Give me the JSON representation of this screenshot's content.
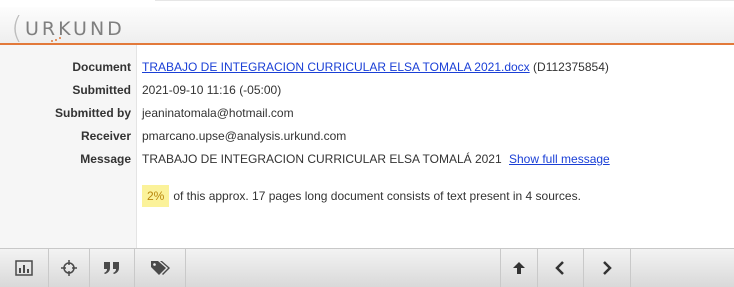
{
  "app": {
    "logo_text": "URKUND",
    "brand_color": "#e2793a"
  },
  "fields": {
    "document_label": "Document",
    "document_link": "TRABAJO DE INTEGRACION CURRICULAR ELSA TOMALA 2021.docx",
    "document_id": "(D112375854)",
    "submitted_label": "Submitted",
    "submitted_value": "2021-09-10 11:16 (-05:00)",
    "submitted_by_label": "Submitted by",
    "submitted_by_value": "jeaninatomala@hotmail.com",
    "receiver_label": "Receiver",
    "receiver_value": "pmarcano.upse@analysis.urkund.com",
    "message_label": "Message",
    "message_value": "TRABAJO DE INTEGRACION CURRICULAR ELSA TOMALÁ 2021",
    "show_full_message": "Show full message"
  },
  "summary": {
    "percent": "2%",
    "text": "of this approx. 17 pages long document consists of text present in 4 sources."
  },
  "toolbar": {
    "icons": [
      "bar-chart-icon",
      "crosshair-icon",
      "quote-icon",
      "tags-icon",
      "arrow-up-icon",
      "chevron-left-icon",
      "chevron-right-icon"
    ]
  }
}
